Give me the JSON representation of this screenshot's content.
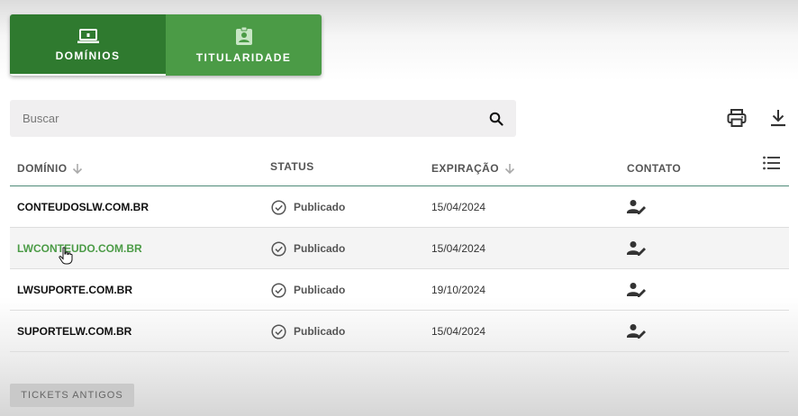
{
  "tabs": [
    {
      "label": "DOMÍNIOS",
      "icon": "laptop-icon",
      "active": true
    },
    {
      "label": "TITULARIDADE",
      "icon": "contact-badge-icon",
      "active": false
    }
  ],
  "search": {
    "placeholder": "Buscar",
    "value": ""
  },
  "toolbar": {
    "print_icon": "print-icon",
    "download_icon": "download-icon"
  },
  "table": {
    "columns": [
      {
        "label": "DOMÍNIO",
        "sortable": true
      },
      {
        "label": "STATUS",
        "sortable": false
      },
      {
        "label": "EXPIRAÇÃO",
        "sortable": true
      },
      {
        "label": "CONTATO",
        "sortable": false
      }
    ],
    "rows": [
      {
        "domain": "CONTEUDOSLW.COM.BR",
        "status": "Publicado",
        "expiration": "15/04/2024"
      },
      {
        "domain": "LWCONTEUDO.COM.BR",
        "status": "Publicado",
        "expiration": "15/04/2024"
      },
      {
        "domain": "LWSUPORTE.COM.BR",
        "status": "Publicado",
        "expiration": "19/10/2024"
      },
      {
        "domain": "SUPORTELW.COM.BR",
        "status": "Publicado",
        "expiration": "15/04/2024"
      }
    ]
  },
  "footer": {
    "old_tickets_label": "TICKETS ANTIGOS"
  },
  "colors": {
    "primary_green": "#2f7a2f",
    "secondary_green": "#4b9b46",
    "link_green": "#4b9b46",
    "divider": "#4f8a78"
  }
}
